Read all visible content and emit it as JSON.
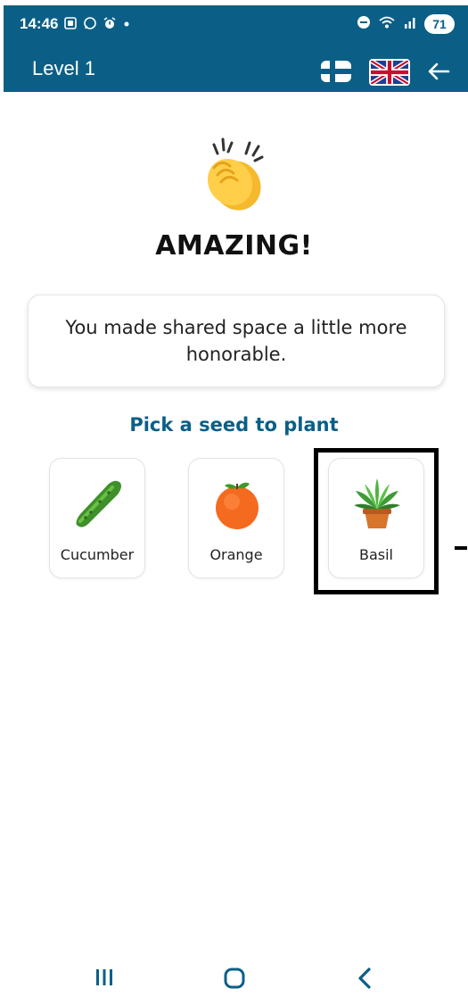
{
  "status_bar": {
    "time": "14:46",
    "left_icons": [
      "screenshot-icon",
      "whatsapp-icon",
      "alarm-icon",
      "notification-dot-icon"
    ],
    "right_icons": [
      "do-not-disturb-icon",
      "wifi-icon",
      "signal-icon"
    ],
    "battery": "71"
  },
  "app_bar": {
    "title": "Level 1",
    "languages": [
      {
        "icon": "finland-flag-icon"
      },
      {
        "icon": "uk-flag-icon",
        "selected": true
      }
    ],
    "back_icon": "arrow-left-icon"
  },
  "celebration": {
    "icon": "clapping-hands-icon",
    "headline": "AMAZING!",
    "message": "You made shared space a little more honorable."
  },
  "seed_picker": {
    "prompt": "Pick a seed to plant",
    "seeds": [
      {
        "label": "Cucumber",
        "icon": "cucumber-icon"
      },
      {
        "label": "Orange",
        "icon": "orange-icon"
      },
      {
        "label": "Basil",
        "icon": "potted-plant-icon",
        "highlighted": true
      }
    ]
  },
  "nav_bar": {
    "buttons": [
      "recent-apps-icon",
      "home-icon",
      "back-icon"
    ]
  },
  "colors": {
    "brand": "#0b5f86",
    "background": "#ffffff",
    "text": "#111111"
  }
}
